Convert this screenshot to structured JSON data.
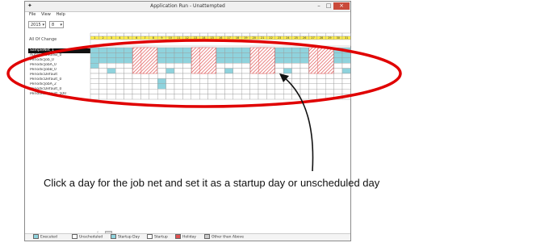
{
  "window": {
    "title": "Application Run - Unattempted",
    "controls": [
      "–",
      "□",
      "×"
    ]
  },
  "menubar": {
    "items": [
      "File",
      "View",
      "Help"
    ]
  },
  "toolbar": {
    "year": {
      "value": "2015"
    },
    "month": {
      "value": "8"
    }
  },
  "job_panel": {
    "header": "All  Of  Change",
    "jobs": [
      {
        "name": "SampleNet_1",
        "selected": true
      },
      {
        "name": "AutoScheduleB_0",
        "selected": false
      },
      {
        "name": "PeriodicJob_0",
        "selected": false
      },
      {
        "name": "PeriodicJobA_0",
        "selected": false
      },
      {
        "name": "PeriodicJobB_0",
        "selected": false
      },
      {
        "name": "PeriodicDefault",
        "selected": false
      },
      {
        "name": "PeriodicDefault_0",
        "selected": false
      },
      {
        "name": "PeriodicJobA_2",
        "selected": false
      },
      {
        "name": "PeriodicDefault_0",
        "selected": false
      },
      {
        "name": "PeriodicDefault_500",
        "selected": false
      }
    ]
  },
  "calendar": {
    "days": 31,
    "highlight_days": [
      6,
      7,
      8,
      15,
      16,
      17,
      18,
      24,
      25,
      26,
      27,
      28,
      29,
      30
    ],
    "weekend_headers": [
      31
    ],
    "unscheduled_columns": [
      5,
      6,
      12,
      13,
      19,
      20,
      26,
      27
    ],
    "rows": 10,
    "startup_pattern": [
      [
        1,
        1,
        1,
        1,
        1,
        1,
        1,
        1,
        1,
        1,
        1,
        1,
        1,
        1,
        1,
        1,
        1,
        1,
        1,
        1,
        1,
        1,
        1,
        1,
        1,
        1,
        1,
        1,
        1,
        1,
        1
      ],
      [
        1,
        1,
        1,
        1,
        1,
        1,
        1,
        1,
        1,
        1,
        1,
        1,
        1,
        1,
        1,
        1,
        1,
        1,
        1,
        1,
        1,
        1,
        1,
        1,
        1,
        1,
        1,
        1,
        1,
        1,
        1
      ],
      [
        1,
        1,
        1,
        1,
        1,
        0,
        0,
        1,
        1,
        1,
        1,
        1,
        0,
        0,
        1,
        1,
        1,
        1,
        1,
        0,
        0,
        1,
        1,
        1,
        1,
        1,
        0,
        0,
        1,
        1,
        1
      ],
      [
        1,
        0,
        0,
        0,
        0,
        0,
        0,
        1,
        0,
        0,
        0,
        0,
        0,
        0,
        1,
        0,
        0,
        0,
        0,
        0,
        0,
        1,
        0,
        0,
        0,
        0,
        0,
        0,
        1,
        0,
        0
      ],
      [
        0,
        0,
        1,
        0,
        0,
        0,
        0,
        0,
        0,
        1,
        0,
        0,
        0,
        0,
        0,
        0,
        1,
        0,
        0,
        0,
        0,
        0,
        0,
        1,
        0,
        0,
        0,
        0,
        0,
        0,
        1
      ],
      [
        0,
        0,
        0,
        0,
        0,
        0,
        0,
        0,
        0,
        0,
        0,
        0,
        0,
        0,
        0,
        0,
        0,
        0,
        0,
        0,
        0,
        0,
        0,
        0,
        0,
        0,
        0,
        0,
        0,
        0,
        0
      ],
      [
        0,
        0,
        0,
        0,
        0,
        0,
        0,
        0,
        1,
        0,
        0,
        0,
        0,
        0,
        0,
        0,
        0,
        0,
        0,
        0,
        0,
        0,
        0,
        0,
        0,
        0,
        0,
        0,
        0,
        0,
        0
      ],
      [
        0,
        0,
        0,
        0,
        0,
        0,
        0,
        0,
        1,
        0,
        0,
        0,
        0,
        0,
        0,
        0,
        0,
        0,
        0,
        0,
        0,
        0,
        0,
        0,
        0,
        0,
        0,
        0,
        0,
        0,
        0
      ],
      [
        0,
        0,
        0,
        0,
        0,
        0,
        0,
        0,
        0,
        0,
        0,
        0,
        0,
        0,
        0,
        0,
        0,
        0,
        0,
        0,
        0,
        0,
        0,
        0,
        0,
        0,
        0,
        0,
        0,
        0,
        0
      ],
      [
        0,
        0,
        0,
        0,
        0,
        0,
        0,
        0,
        0,
        0,
        0,
        0,
        0,
        0,
        0,
        0,
        0,
        0,
        0,
        0,
        0,
        0,
        0,
        0,
        0,
        0,
        0,
        0,
        0,
        0,
        0
      ]
    ]
  },
  "statusbar": {
    "legend": [
      {
        "label": "Executed",
        "color": "#8fd3dd"
      },
      {
        "label": "Unscheduled",
        "color": "#ffffff"
      },
      {
        "label": "Startup Day",
        "color": "#8fd3dd"
      },
      {
        "label": "Startup",
        "color": "#ffffff"
      },
      {
        "label": "Holiday",
        "color": "#e05050"
      },
      {
        "label": "Other than Above",
        "color": "#cccccc"
      }
    ]
  },
  "annotation": {
    "text": "Click a day for the job net and set it as a startup day or unscheduled day",
    "ellipse_color": "#e00000"
  },
  "colors": {
    "startup_fill": "#8fd3dd",
    "header_fill": "#ffef4a",
    "hatch": "#e05050"
  }
}
